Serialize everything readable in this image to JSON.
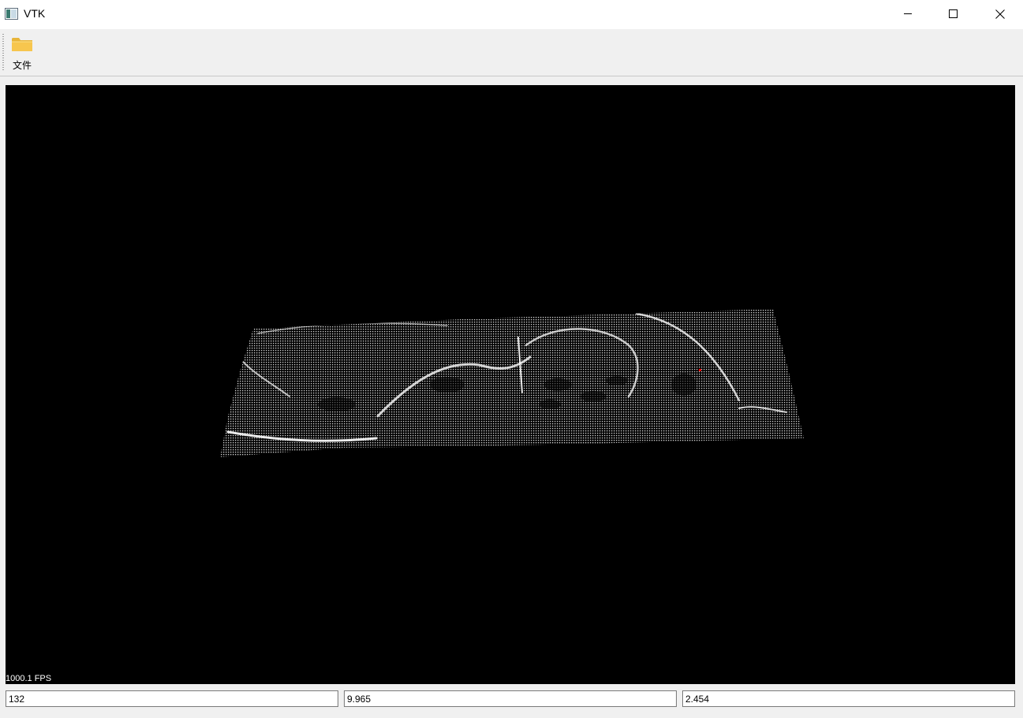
{
  "window": {
    "title": "VTK",
    "icon": "app-window-icon",
    "controls": [
      "minimize-icon",
      "maximize-icon",
      "close-icon"
    ]
  },
  "toolbar": {
    "file": {
      "label": "文件",
      "icon": "folder-icon",
      "icon_color": "#f7c64e"
    }
  },
  "viewport": {
    "background": "#000000",
    "mesh_color": "#ffffff",
    "marker_color": "#ff0000",
    "fps_text": "1000.1 FPS"
  },
  "coords": {
    "field1": "132",
    "field2": "9.965",
    "field3": "2.454"
  }
}
